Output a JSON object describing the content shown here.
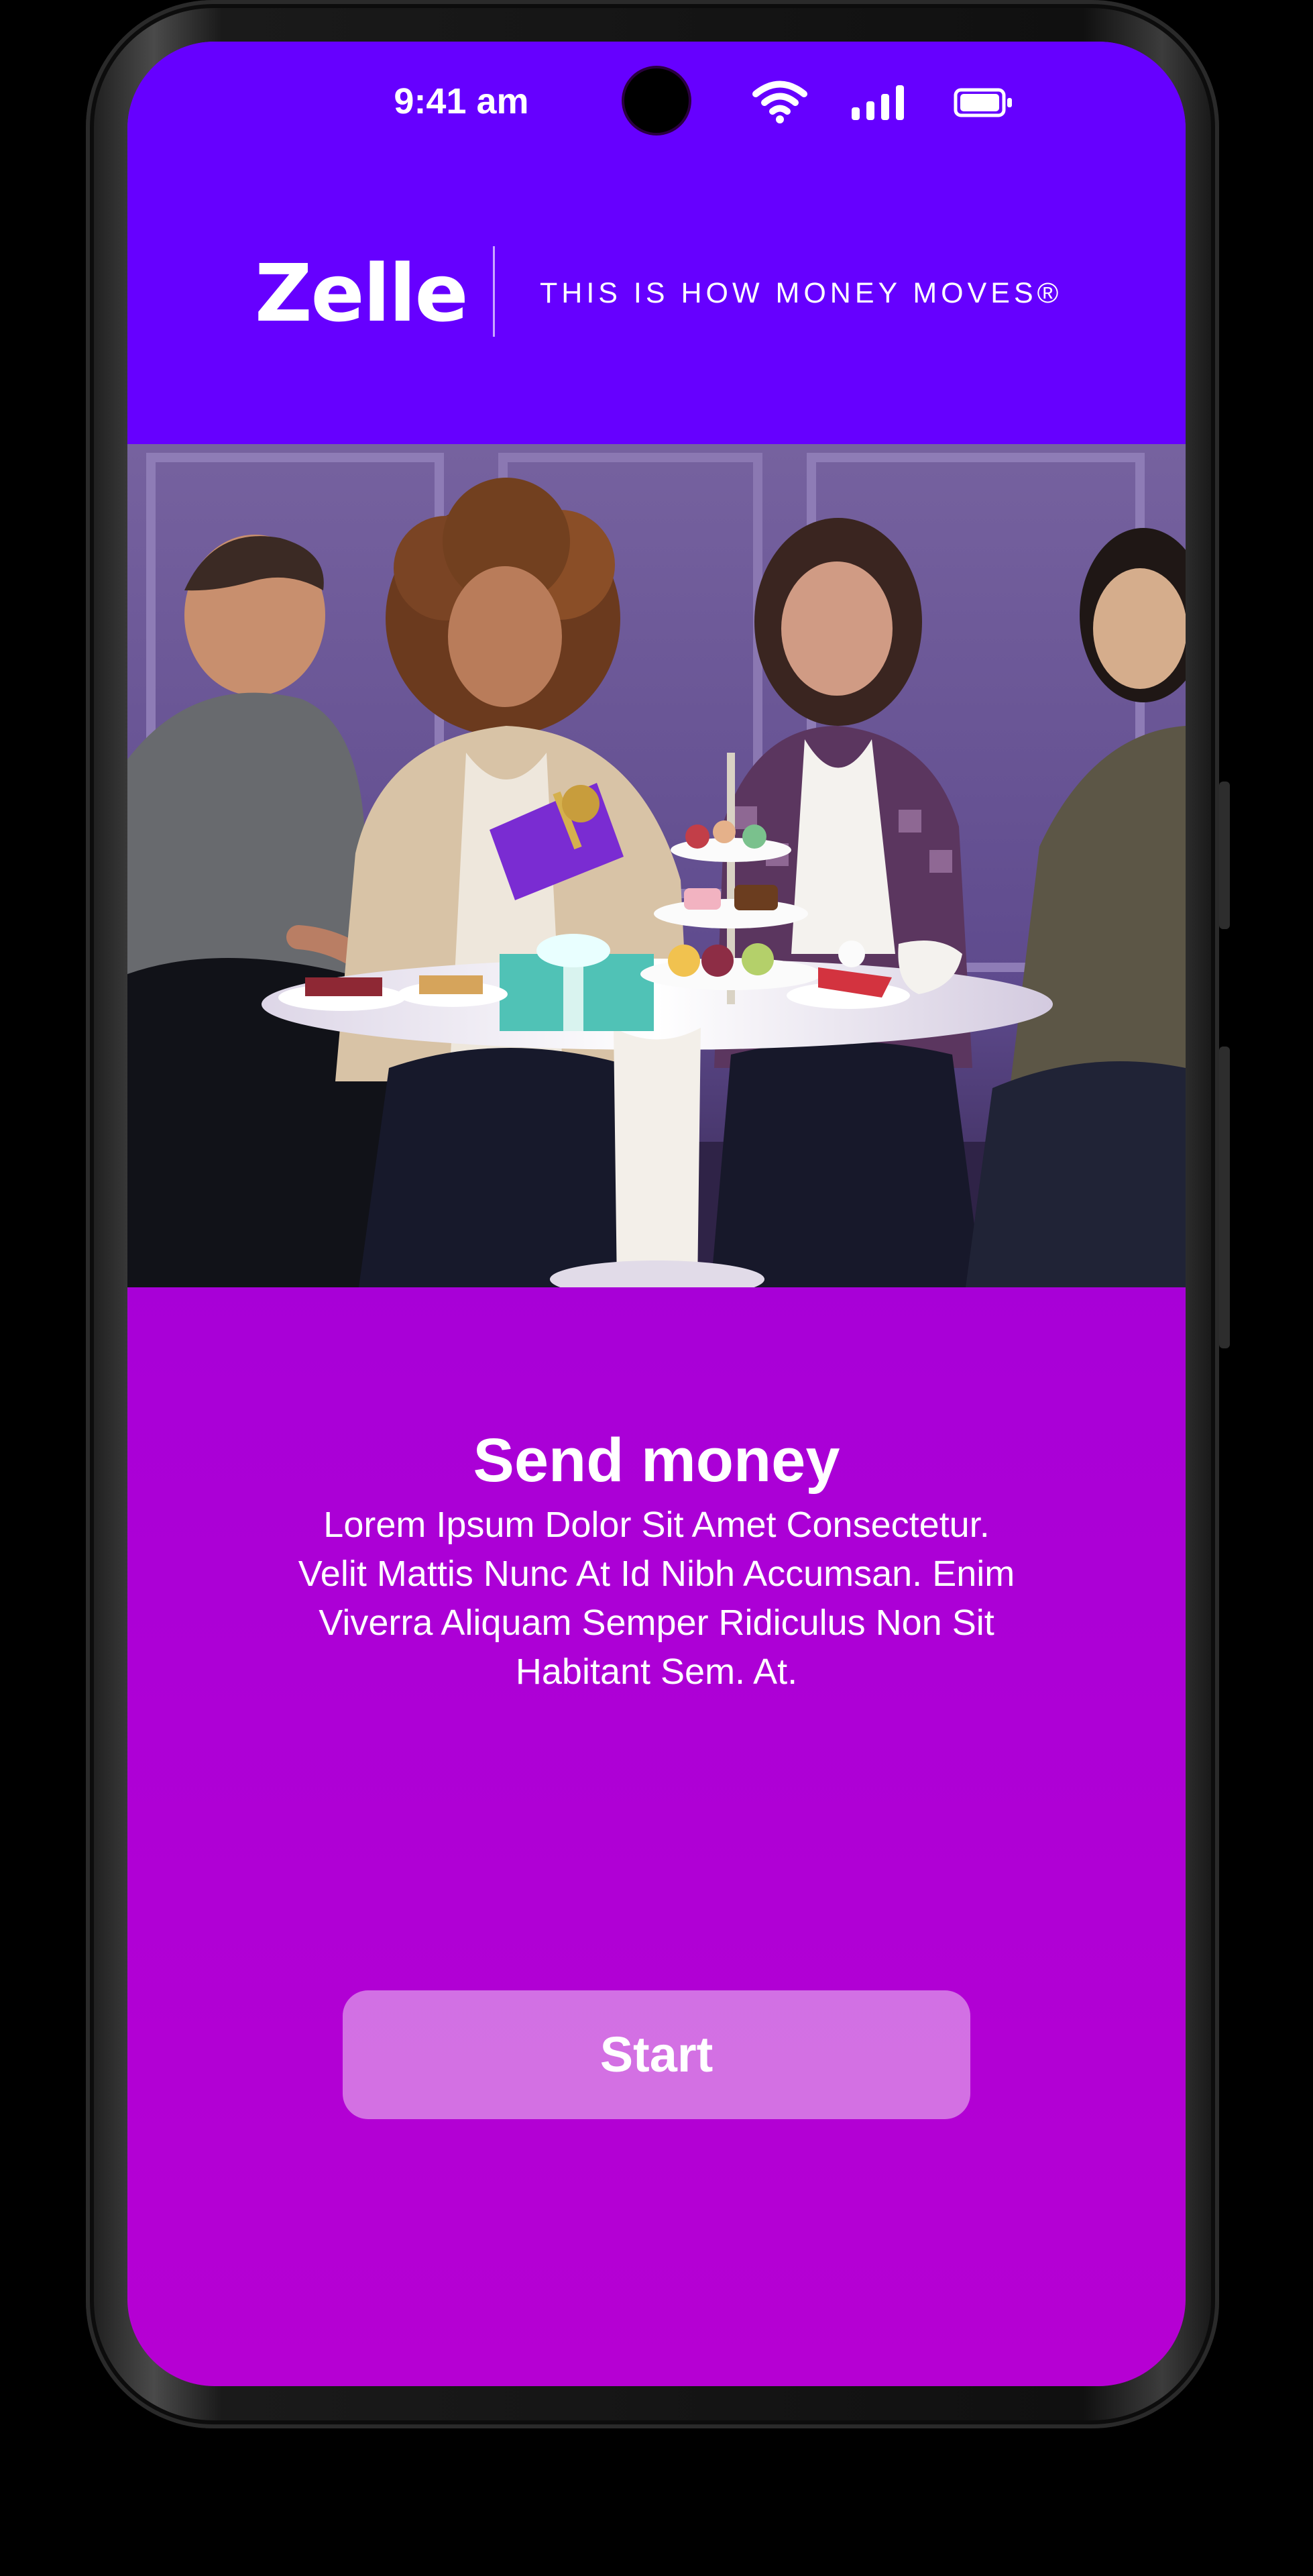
{
  "status_bar": {
    "time": "9:41 am",
    "icons": [
      "camera-hole",
      "wifi-icon",
      "cellular-signal-icon",
      "battery-icon"
    ]
  },
  "brand": {
    "logo_text": "Zelle",
    "tagline": "THIS IS HOW MONEY MOVES®"
  },
  "hero_image": {
    "description_name": "people-at-table-photo"
  },
  "main": {
    "title": "Send money",
    "description": "Lorem Ipsum Dolor Sit Amet Consectetur. Velit Mattis Nunc At Id Nibh Accumsan. Enim Viverra Aliquam Semper Ridiculus Non Sit Habitant Sem. At.",
    "start_label": "Start"
  },
  "colors": {
    "brand_purple": "#6600FF",
    "content_purple_top": "#9600DD",
    "content_purple_bottom": "#B600D3",
    "button_fill": "#DD95E8",
    "text": "#FFFFFF"
  }
}
